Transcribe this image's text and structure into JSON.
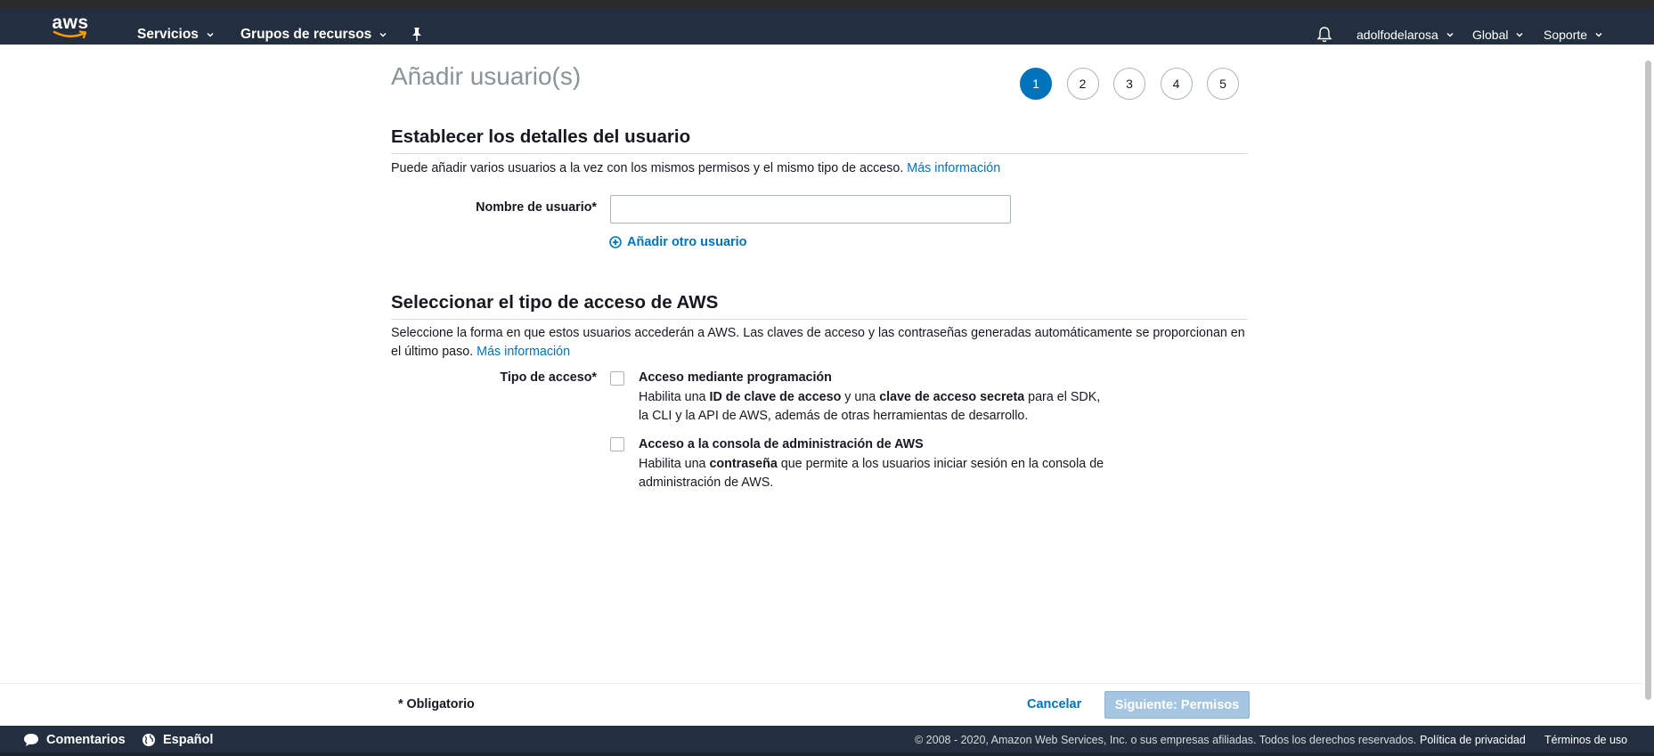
{
  "header": {
    "logo_text": "aws",
    "nav": [
      {
        "label": "Servicios"
      },
      {
        "label": "Grupos de recursos"
      }
    ],
    "user": "adolfodelarosa",
    "region": "Global",
    "support": "Soporte"
  },
  "page": {
    "title": "Añadir usuario(s)",
    "steps": [
      "1",
      "2",
      "3",
      "4",
      "5"
    ],
    "active_step": "1"
  },
  "details": {
    "heading": "Establecer los detalles del usuario",
    "description": "Puede añadir varios usuarios a la vez con los mismos permisos y el mismo tipo de acceso.",
    "more_info": "Más información",
    "username_label": "Nombre de usuario*",
    "username_value": "",
    "add_user": "Añadir otro usuario"
  },
  "access": {
    "heading": "Seleccionar el tipo de acceso de AWS",
    "description": "Seleccione la forma en que estos usuarios accederán a AWS. Las claves de acceso y las contraseñas generadas automáticamente se proporcionan en el último paso.",
    "more_info": "Más información",
    "label": "Tipo de acceso*",
    "options": [
      {
        "title": "Acceso mediante programación",
        "desc_parts": [
          "Habilita una ",
          "ID de clave de acceso",
          " y una ",
          "clave de acceso secreta",
          " para el SDK, la CLI y la API de AWS, además de otras herramientas de desarrollo."
        ],
        "checked": false
      },
      {
        "title": "Acceso a la consola de administración de AWS",
        "desc_parts": [
          "Habilita una ",
          "contraseña",
          " que permite a los usuarios iniciar sesión en la consola de administración de AWS."
        ],
        "checked": false
      }
    ]
  },
  "footer": {
    "required_note": "* Obligatorio",
    "cancel": "Cancelar",
    "next": "Siguiente: Permisos"
  },
  "bottom": {
    "feedback": "Comentarios",
    "language": "Español",
    "copyright": "© 2008 - 2020, Amazon Web Services, Inc. o sus empresas afiliadas. Todos los derechos reservados.",
    "privacy": "Política de privacidad",
    "terms": "Términos de uso"
  },
  "colors": {
    "header_bg": "#232f3e",
    "link": "#0073bb",
    "step_active": "#0073bb",
    "button_disabled": "#a6c5e0"
  }
}
